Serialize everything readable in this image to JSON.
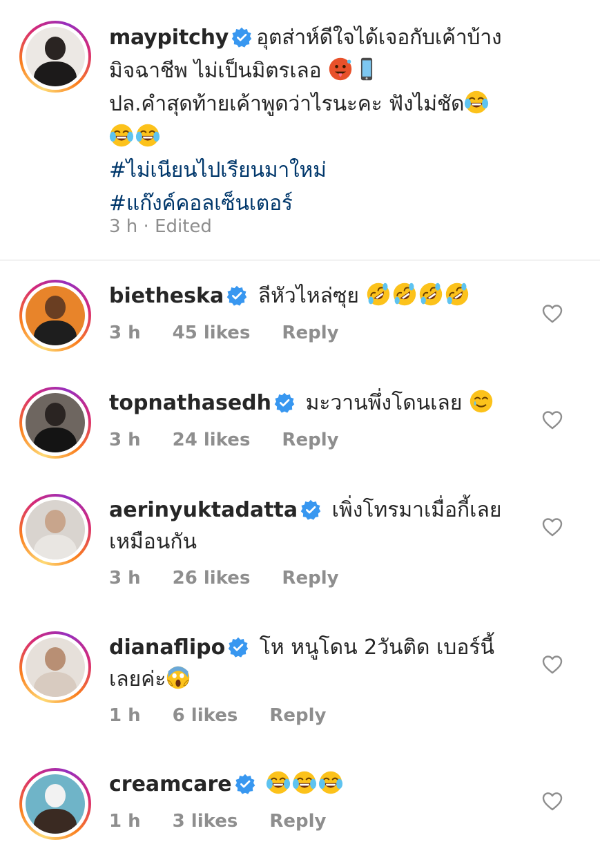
{
  "post": {
    "username": "maypitchy",
    "line1": "อุตส่าห์ดีใจได้เจอกับเค้าบ้าง",
    "line2": "มิจฉาชีพ ไม่เป็นมิตรเลอ",
    "line3": "ปล.คำสุดท้ายเค้าพูดว่าไรนะคะ ฟังไม่ชัด",
    "hashtags": [
      "#ไม่เนียนไปเรียนมาใหม่",
      "#แก๊งค์คอลเซ็นเตอร์"
    ],
    "meta": "3 h · Edited"
  },
  "comments": [
    {
      "username": "bietheska",
      "text": "ลีหัวไหล่ซุย",
      "time": "3 h",
      "likes": "45 likes",
      "reply": "Reply"
    },
    {
      "username": "topnathasedh",
      "text": "มะวานพึ่งโดนเลย",
      "time": "3 h",
      "likes": "24 likes",
      "reply": "Reply"
    },
    {
      "username": "aerinyuktadatta",
      "text": "เพิ่งโทรมาเมื่อกี้เลย",
      "text2": "เหมือนกัน",
      "time": "3 h",
      "likes": "26 likes",
      "reply": "Reply"
    },
    {
      "username": "dianaflipo",
      "text": "โห หนูโดน 2วันติด เบอร์นี้",
      "text2": "เลยค่ะ",
      "time": "1 h",
      "likes": "6 likes",
      "reply": "Reply"
    },
    {
      "username": "creamcare",
      "text": "",
      "time": "1 h",
      "likes": "3 likes",
      "reply": "Reply"
    }
  ],
  "colors": {
    "verified": "#3897f0",
    "hashtag": "#00376b",
    "meta": "#8e8e8e",
    "heart": "#8e8e8e"
  },
  "icons": [
    "verified-badge-icon",
    "heart-icon",
    "laughing-emoji-icon",
    "rolling-laughing-emoji-icon",
    "hot-face-emoji-icon",
    "mobile-phone-emoji-icon",
    "smiling-tear-emoji-icon",
    "screaming-emoji-icon"
  ]
}
